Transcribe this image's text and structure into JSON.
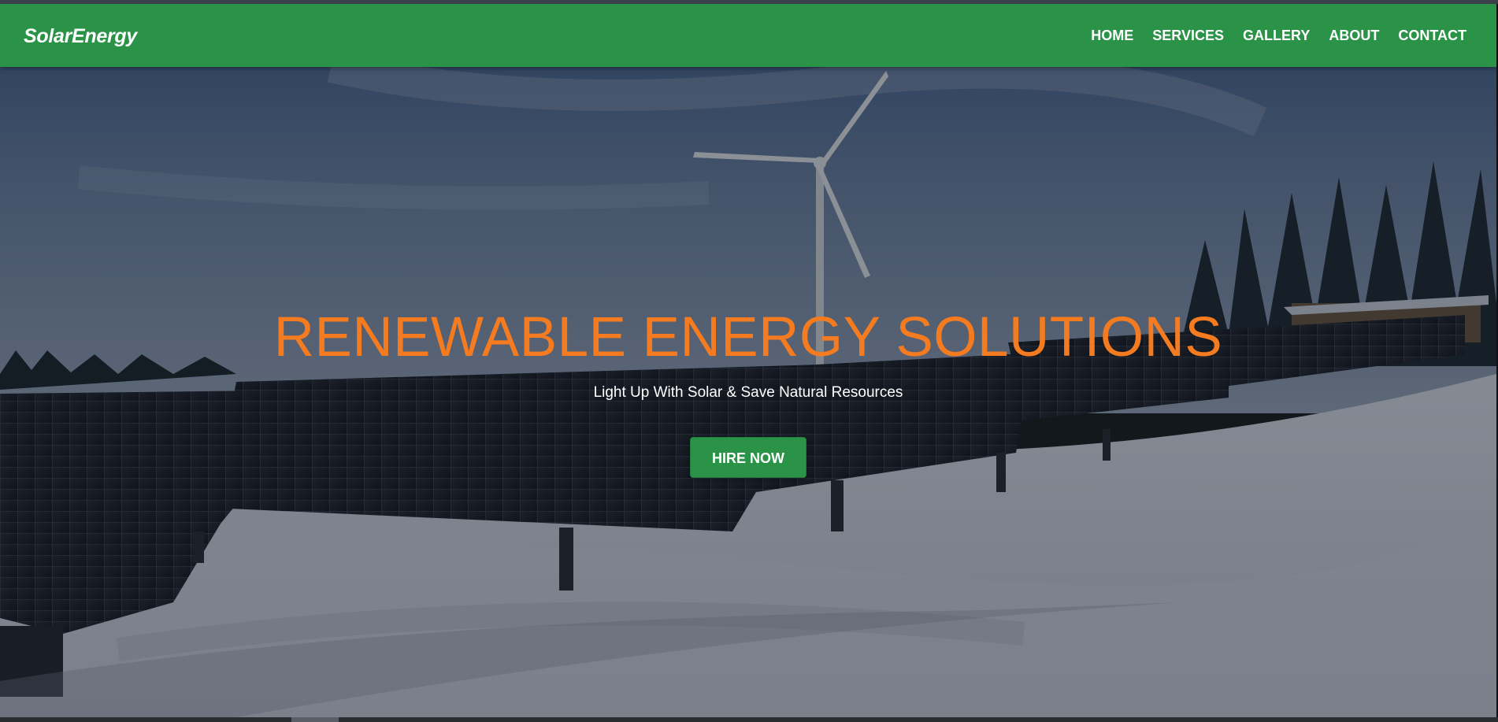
{
  "brand": "SolarEnergy",
  "nav": {
    "items": [
      {
        "label": "HOME"
      },
      {
        "label": "SERVICES"
      },
      {
        "label": "GALLERY"
      },
      {
        "label": "ABOUT"
      },
      {
        "label": "CONTACT"
      }
    ]
  },
  "hero": {
    "title": "RENEWABLE ENERGY SOLUTIONS",
    "subtitle": "Light Up With Solar & Save Natural Resources",
    "cta_label": "HIRE NOW",
    "background_description_icon": "solar-panels-wind-turbine-snow-photo"
  },
  "colors": {
    "nav_bg": "#2b9348",
    "accent_orange": "#f47b20",
    "button_bg": "#2b9348",
    "text_white": "#ffffff"
  }
}
